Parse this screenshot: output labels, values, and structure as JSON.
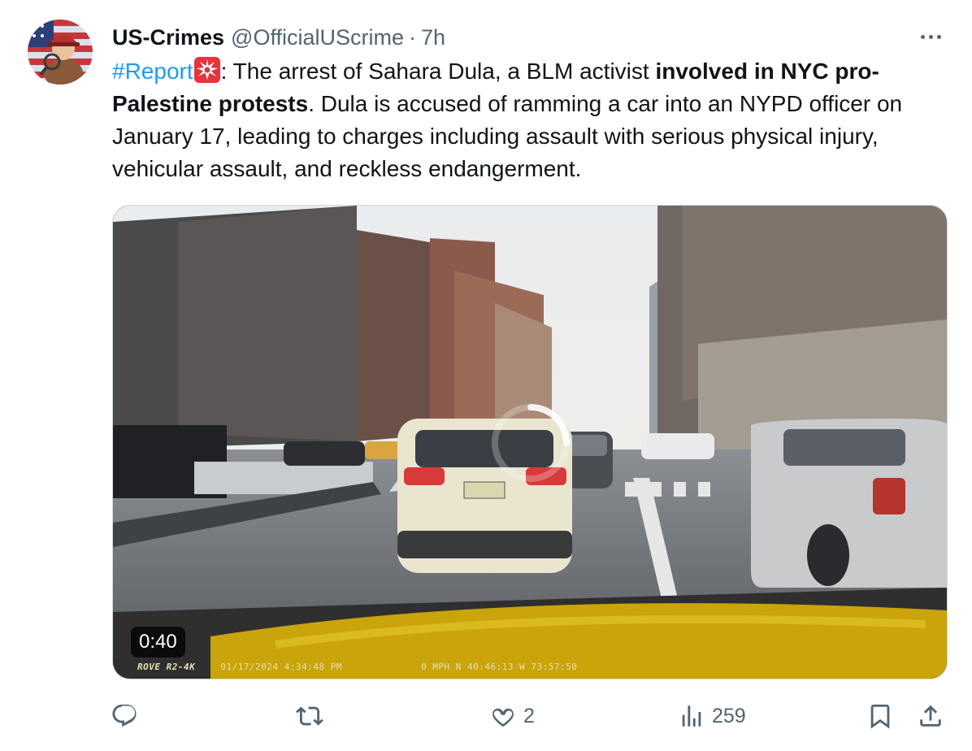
{
  "tweet": {
    "author": {
      "name": "US-Crimes",
      "handle": "@OfficialUScrime",
      "separator": "·",
      "time": "7h"
    },
    "text": {
      "hashtag": "#Report",
      "emoji": "siren-emoji",
      "part1": ": The arrest of Sahara Dula, a BLM activist ",
      "bold1": "involved in NYC pro-Palestine protests",
      "part2": ". Dula is accused of ramming a car into an NYPD officer on January 17, leading to charges including assault with serious physical injury, vehicular assault, and reckless endangerment."
    },
    "media": {
      "type": "video",
      "duration": "0:40",
      "dashcam_brand": "ROVE R2-4K",
      "dashcam_timestamp": "01/17/2024 4:34:48 PM",
      "dashcam_speed": "0 MPH N 40:46:13 W 73:57:50"
    },
    "actions": {
      "reply": {
        "icon": "reply-icon",
        "count": ""
      },
      "repost": {
        "icon": "repost-icon",
        "count": ""
      },
      "like": {
        "icon": "heart-icon",
        "count": "2"
      },
      "views": {
        "icon": "views-icon",
        "count": "259"
      },
      "bookmark": {
        "icon": "bookmark-icon"
      },
      "share": {
        "icon": "share-icon"
      }
    },
    "colors": {
      "accent": "#1d9bf0",
      "secondary_text": "#536471",
      "primary_text": "#0f1419",
      "border": "#cfd9de"
    }
  }
}
